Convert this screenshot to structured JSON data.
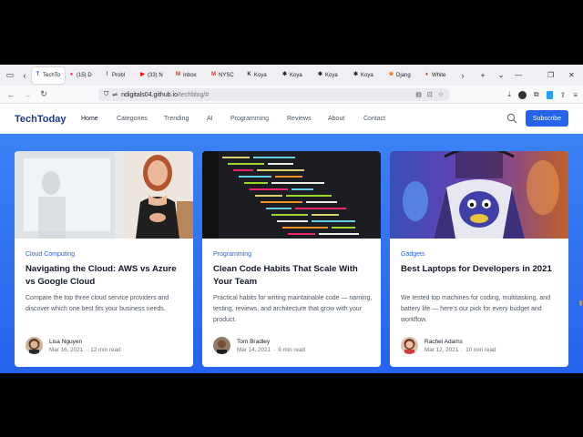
{
  "browser": {
    "tabs": [
      {
        "label": "TechTo",
        "favicon": "T",
        "color": "#2563eb",
        "active": true
      },
      {
        "label": "(15) D",
        "favicon": "●",
        "color": "#e1306c"
      },
      {
        "label": "Probl",
        "favicon": "!",
        "color": "#444444"
      },
      {
        "label": "(33) N",
        "favicon": "▶",
        "color": "#ff0000"
      },
      {
        "label": "Inbox",
        "favicon": "M",
        "color": "#d93025"
      },
      {
        "label": "NYSC",
        "favicon": "M",
        "color": "#d93025"
      },
      {
        "label": "Koya",
        "favicon": "K",
        "color": "#333333"
      },
      {
        "label": "Koya",
        "favicon": "✱",
        "color": "#222222"
      },
      {
        "label": "Koya",
        "favicon": "✱",
        "color": "#222222"
      },
      {
        "label": "Koya",
        "favicon": "✱",
        "color": "#222222"
      },
      {
        "label": "Djang",
        "favicon": "❀",
        "color": "#e8710a"
      },
      {
        "label": "White",
        "favicon": "♦",
        "color": "#9c5b2a"
      }
    ],
    "url": {
      "host": "ndigitals04.github.io",
      "path": "/techblog/#"
    }
  },
  "site": {
    "logo": "TechToday",
    "menu": [
      "Home",
      "Categories",
      "Trending",
      "AI",
      "Programming",
      "Reviews",
      "About",
      "Contact"
    ],
    "subscribe_label": "Subscribe"
  },
  "cards": [
    {
      "category": "Cloud Computing",
      "title": "Navigating the Cloud: AWS vs Azure vs Google Cloud",
      "description": "Compare the top three cloud service providers and discover which one best fits your business needs.",
      "author": "Lisa Nguyen",
      "date": "Mar 16, 2021",
      "read_time": "12 min read"
    },
    {
      "category": "Programming",
      "title": "Clean Code Habits That Scale With Your Team",
      "description": "Practical habits for writing maintainable code — naming, testing, reviews, and architecture that grow with your product.",
      "author": "Tom Bradley",
      "date": "Mar 14, 2021",
      "read_time": "9 min read"
    },
    {
      "category": "Gadgets",
      "title": "Best Laptops for Developers in 2021",
      "description": "We tested top machines for coding, multitasking, and battery life — here's our pick for every budget and workflow.",
      "author": "Rachel Adams",
      "date": "Mar 12, 2021",
      "read_time": "10 min read"
    }
  ],
  "colors": {
    "accent": "#2563eb",
    "logo": "#1e3a8a",
    "hero": "#3b82f6"
  }
}
